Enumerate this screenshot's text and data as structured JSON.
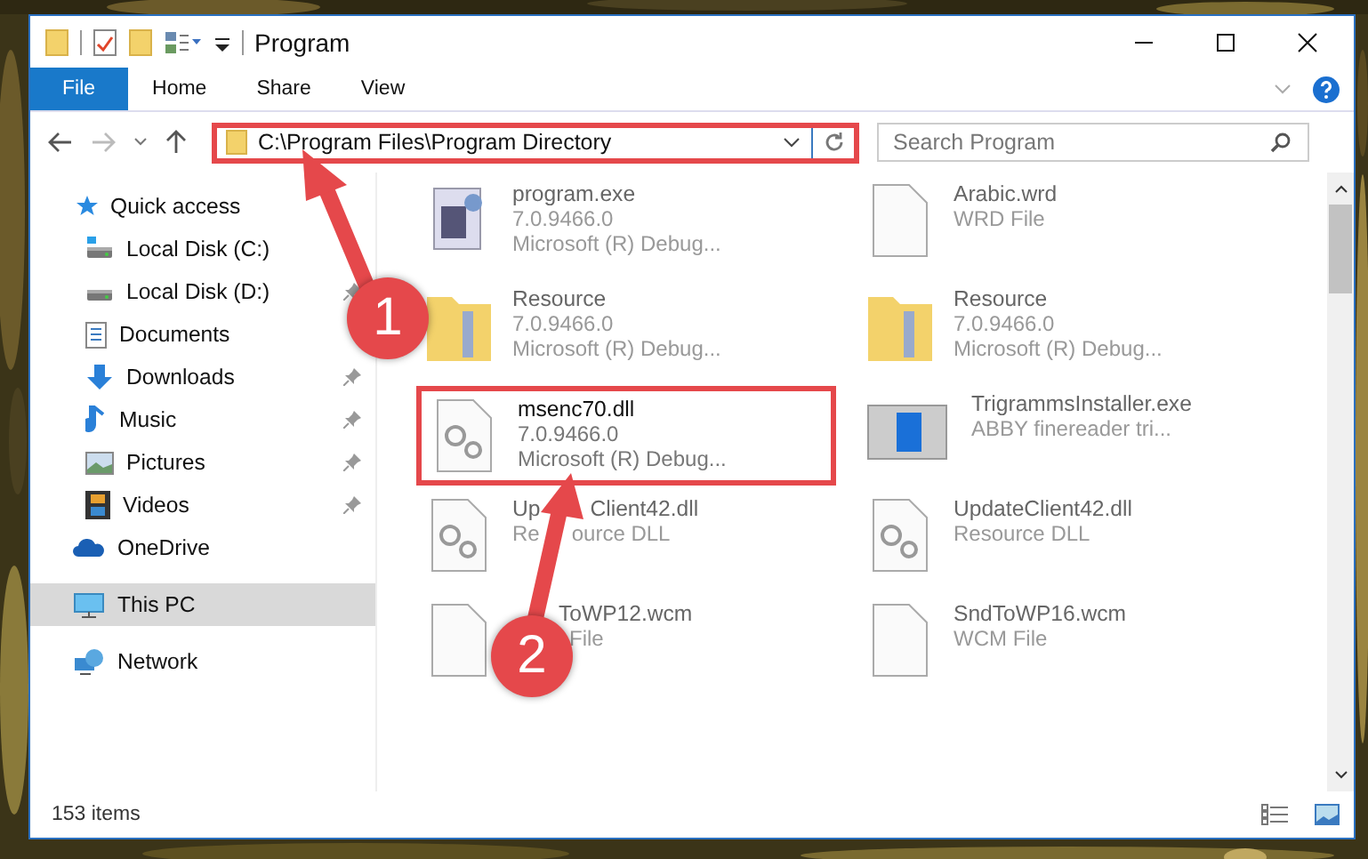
{
  "window": {
    "title": "Program"
  },
  "ribbon_tabs": [
    {
      "label": "File",
      "kind": "file"
    },
    {
      "label": "Home",
      "kind": "tab"
    },
    {
      "label": "Share",
      "kind": "tab"
    },
    {
      "label": "View",
      "kind": "tab"
    }
  ],
  "address_bar": {
    "path": "C:\\Program Files\\Program Directory",
    "highlighted": true
  },
  "search": {
    "placeholder": "Search Program"
  },
  "sidebar": {
    "items": [
      {
        "label": "Quick access",
        "selected": false,
        "children": [
          {
            "label": "Local Disk (C:)",
            "pinned": false
          },
          {
            "label": "Local Disk (D:)",
            "pinned": true
          },
          {
            "label": "Documents",
            "pinned": false
          },
          {
            "label": "Downloads",
            "pinned": true
          },
          {
            "label": "Music",
            "pinned": true
          },
          {
            "label": "Pictures",
            "pinned": true
          },
          {
            "label": "Videos",
            "pinned": true
          }
        ]
      },
      {
        "label": "OneDrive",
        "selected": false
      },
      {
        "label": "This PC",
        "selected": true
      },
      {
        "label": "Network",
        "selected": false
      }
    ]
  },
  "files": [
    {
      "name": "program.exe",
      "kind": "app",
      "lines": [
        "7.0.9466.0",
        "Microsoft (R) Debug..."
      ],
      "blurred": true,
      "highlighted": false
    },
    {
      "name": "Arabic.wrd",
      "kind": "file",
      "lines": [
        "WRD File"
      ],
      "blurred": true,
      "highlighted": false
    },
    {
      "name": "Resource",
      "kind": "folder",
      "lines": [
        "7.0.9466.0",
        "Microsoft (R) Debug..."
      ],
      "blurred": true,
      "highlighted": false
    },
    {
      "name": "Resource",
      "kind": "folder",
      "lines": [
        "7.0.9466.0",
        "Microsoft (R) Debug..."
      ],
      "blurred": true,
      "highlighted": false
    },
    {
      "name": "msenc70.dll",
      "kind": "dll",
      "lines": [
        "7.0.9466.0",
        "Microsoft (R) Debug..."
      ],
      "blurred": false,
      "highlighted": true
    },
    {
      "name": "TrigrammsInstaller.exe",
      "kind": "installer",
      "lines": [
        "ABBY finereader tri..."
      ],
      "blurred": true,
      "highlighted": false
    },
    {
      "name": [
        "Up",
        "Client42.dll"
      ],
      "kind": "dll",
      "lines": [
        [
          "Re",
          "ource DLL"
        ]
      ],
      "blurred": true,
      "highlighted": false
    },
    {
      "name": "UpdateClient42.dll",
      "kind": "dll",
      "lines": [
        "Resource DLL"
      ],
      "blurred": true,
      "highlighted": false
    },
    {
      "name": [
        "ToWP12.wcm"
      ],
      "kind": "file",
      "lines": [
        [
          "File"
        ]
      ],
      "blurred": true,
      "highlighted": false,
      "lead_hidden": true
    },
    {
      "name": "SndToWP16.wcm",
      "kind": "file",
      "lines": [
        "WCM File"
      ],
      "blurred": true,
      "highlighted": false
    }
  ],
  "status_bar": {
    "item_count": "153 items"
  },
  "annotations": [
    {
      "number": "1"
    },
    {
      "number": "2"
    }
  ]
}
